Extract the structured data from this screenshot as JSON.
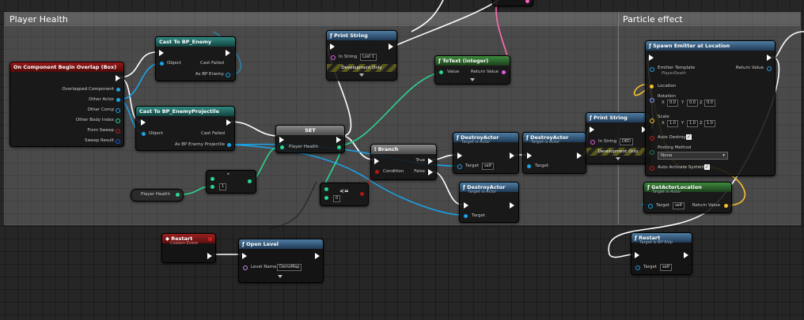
{
  "comments": {
    "player_health": "Player Health",
    "particle_effect": "Particle effect"
  },
  "nodes": {
    "overlap": {
      "title": "On Component Begin Overlap (Box)",
      "pins": [
        "Overlapped Component",
        "Other Actor",
        "Other Comp",
        "Other Body Index",
        "From Sweep",
        "Sweep Result"
      ]
    },
    "cast_enemy": {
      "title": "Cast To BP_Enemy",
      "object": "Object",
      "cast_failed": "Cast Failed",
      "as_out": "As BP Enemy"
    },
    "cast_proj": {
      "title": "Cast To BP_EnemyProjectile",
      "object": "Object",
      "cast_failed": "Cast Failed",
      "as_out": "As BP Enemy Projectile"
    },
    "print1": {
      "title": "Print String",
      "in_string": "In String",
      "value": "Lost 1",
      "dev": "Development Only"
    },
    "totext": {
      "title": "ToText (integer)",
      "value": "Value",
      "return": "Return Value"
    },
    "set": {
      "title": "SET",
      "pin": "Player Health"
    },
    "get_health": {
      "label": "Player Health"
    },
    "minus": {
      "value": "1",
      "symbol": "-"
    },
    "compare": {
      "value": "0",
      "symbol": "<="
    },
    "branch": {
      "title": "Branch",
      "true": "True",
      "false": "False",
      "condition": "Condition"
    },
    "destroy1": {
      "title": "DestroyActor",
      "sub": "Target is Actor",
      "target": "Target",
      "value": "self"
    },
    "destroy2": {
      "title": "DestroyActor",
      "sub": "Target is Actor",
      "target": "Target"
    },
    "destroy3": {
      "title": "DestroyActor",
      "sub": "Target is Actor",
      "target": "Target"
    },
    "print2": {
      "title": "Print String",
      "in_string": "In String",
      "value": "DED",
      "dev": "Development Only"
    },
    "spawn": {
      "title": "Spawn Emitter at Location",
      "emitter_template": "Emitter Template",
      "emitter_value": "PlayerDeath",
      "return": "Return Value",
      "location": "Location",
      "rotation": "Rotation",
      "scale": "Scale",
      "rot": [
        "X",
        "0.0",
        "Y",
        "0.0",
        "Z",
        "0.0"
      ],
      "scl": [
        "X",
        "1.0",
        "Y",
        "1.0",
        "Z",
        "1.0"
      ],
      "auto_destroy": "Auto Destroy",
      "pooling": "Pooling Method",
      "pooling_value": "None",
      "auto_activate": "Auto Activate System"
    },
    "getloc": {
      "title": "GetActorLocation",
      "sub": "Target is Actor",
      "target": "Target",
      "value": "self",
      "return": "Return Value"
    },
    "restart_event": {
      "title": "Restart",
      "sub": "Custom Event"
    },
    "open_level": {
      "title": "Open Level",
      "level_name": "Level Name",
      "value": "DemoMap"
    },
    "restart_call": {
      "title": "Restart",
      "sub": "Target is BP Ship",
      "target": "Target",
      "value": "self"
    }
  },
  "colors": {
    "exec": "#ffffff",
    "object": "#1aa3e8",
    "float": "#2bd68e",
    "text": "#e35ce3",
    "bool": "#a01818",
    "vector": "#f5c12e",
    "string": "#ff58c8"
  }
}
